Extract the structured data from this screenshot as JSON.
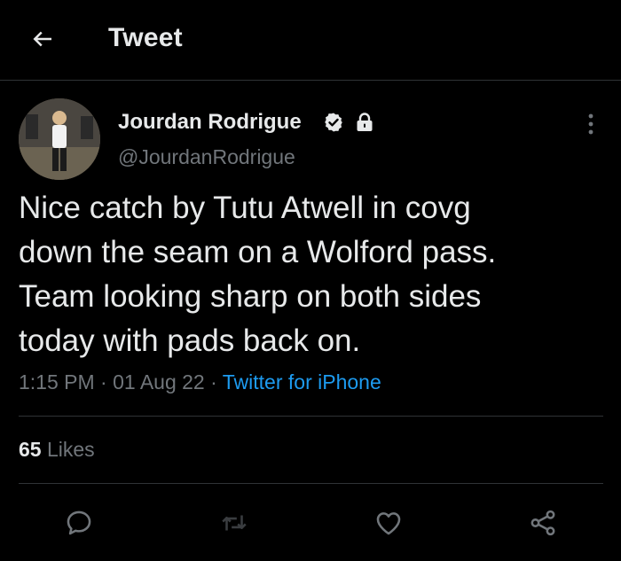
{
  "header": {
    "title": "Tweet",
    "back_icon": "arrow-left-icon"
  },
  "tweet": {
    "author_name": "Jourdan Rodrigue",
    "handle": "@JourdanRodrigue",
    "verified_icon": "verified-badge-icon",
    "protected_icon": "lock-icon",
    "text": "Nice catch by Tutu Atwell in covg\ndown the seam on a Wolford pass.\nTeam looking sharp on both sides\ntoday with pads back on.",
    "time": "1:15 PM",
    "separator": "·",
    "date": "01 Aug 22",
    "source": "Twitter for iPhone",
    "likes_count": "65",
    "likes_label": "Likes"
  },
  "actions": {
    "reply_icon": "reply-icon",
    "retweet_icon": "retweet-icon",
    "like_icon": "heart-icon",
    "share_icon": "share-icon",
    "more_icon": "more-vertical-icon"
  },
  "colors": {
    "background": "#000000",
    "text_primary": "#e7e9ea",
    "text_secondary": "#71767b",
    "accent": "#1d9bf0",
    "divider": "#2f3336"
  }
}
